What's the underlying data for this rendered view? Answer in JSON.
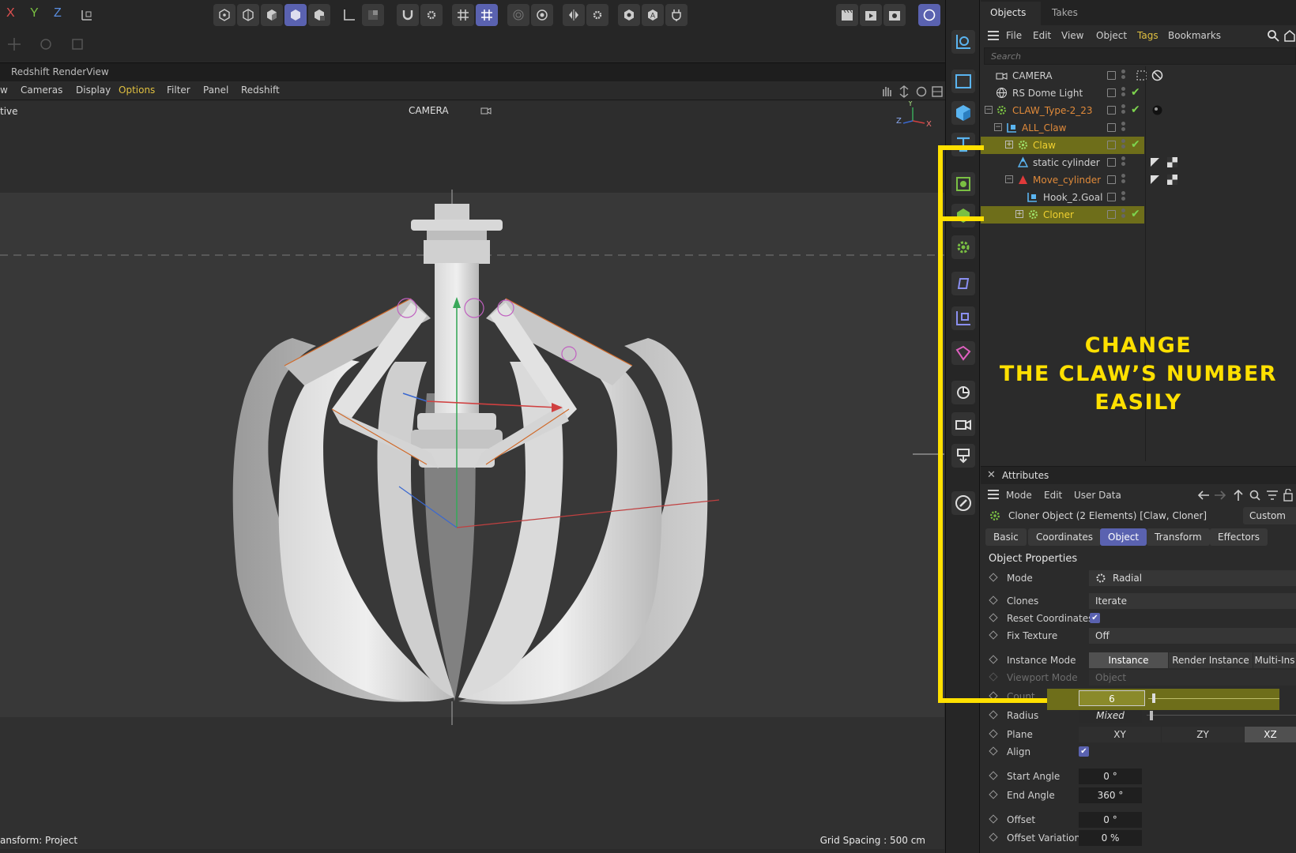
{
  "toolbar": {
    "axis_x": "X",
    "axis_y": "Y",
    "axis_z": "Z"
  },
  "viewport": {
    "window_title": "Redshift RenderView",
    "menu": [
      "w",
      "Cameras",
      "Display",
      "Options",
      "Filter",
      "Panel",
      "Redshift"
    ],
    "left_label": "tive",
    "camera_label": "CAMERA",
    "status_left": "ansform: Project",
    "grid_spacing": "Grid Spacing : 500 cm",
    "gizmo": {
      "y": "Y",
      "z": "Z",
      "x": "X"
    }
  },
  "objects_panel": {
    "tabs": [
      "Objects",
      "Takes"
    ],
    "menu": [
      "File",
      "Edit",
      "View",
      "Object",
      "Tags",
      "Bookmarks"
    ],
    "search_placeholder": "Search",
    "rows": [
      {
        "name": "CAMERA",
        "color": "#cfcfcf"
      },
      {
        "name": "RS Dome Light",
        "color": "#cfcfcf"
      },
      {
        "name": "CLAW_Type-2_23",
        "color": "#e08a3a"
      },
      {
        "name": "ALL_Claw",
        "color": "#e08a3a"
      },
      {
        "name": "Claw",
        "color": "#f0d030"
      },
      {
        "name": "static cylinder",
        "color": "#cfcfcf"
      },
      {
        "name": "Move_cylinder",
        "color": "#e08a3a"
      },
      {
        "name": "Hook_2.Goal",
        "color": "#cfcfcf"
      },
      {
        "name": "Cloner",
        "color": "#f0d030"
      }
    ]
  },
  "annotation": {
    "line1": "CHANGE",
    "line2": "THE CLAW’S NUMBER",
    "line3": "EASILY",
    "color": "#ffe000"
  },
  "attributes": {
    "title": "Attributes",
    "menu": [
      "Mode",
      "Edit",
      "User Data"
    ],
    "object_name": "Cloner Object (2 Elements) [Claw, Cloner]",
    "preset": "Custom",
    "tabs": [
      "Basic",
      "Coordinates",
      "Object",
      "Transform",
      "Effectors"
    ],
    "section": "Object Properties",
    "props": {
      "mode_label": "Mode",
      "mode_value": "Radial",
      "clones_label": "Clones",
      "clones_value": "Iterate",
      "reset_label": "Reset Coordinates",
      "fix_label": "Fix Texture",
      "fix_value": "Off",
      "instance_label": "Instance Mode",
      "instance_options": [
        "Instance",
        "Render Instance",
        "Multi-Ins"
      ],
      "viewport_label": "Viewport Mode",
      "viewport_value": "Object",
      "count_label": "Count",
      "count_value": "6",
      "radius_label": "Radius",
      "radius_value": "Mixed",
      "plane_label": "Plane",
      "plane_options": [
        "XY",
        "ZY",
        "XZ"
      ],
      "align_label": "Align",
      "start_label": "Start Angle",
      "start_value": "0 °",
      "end_label": "End Angle",
      "end_value": "360 °",
      "offset_label": "Offset",
      "offset_value": "0 °",
      "offset_var_label": "Offset Variation",
      "offset_var_value": "0 %"
    }
  },
  "colors": {
    "accent": "#5a62b0",
    "highlight": "#6e6e1a",
    "annotation": "#ffe000",
    "check": "#7dd34e"
  }
}
